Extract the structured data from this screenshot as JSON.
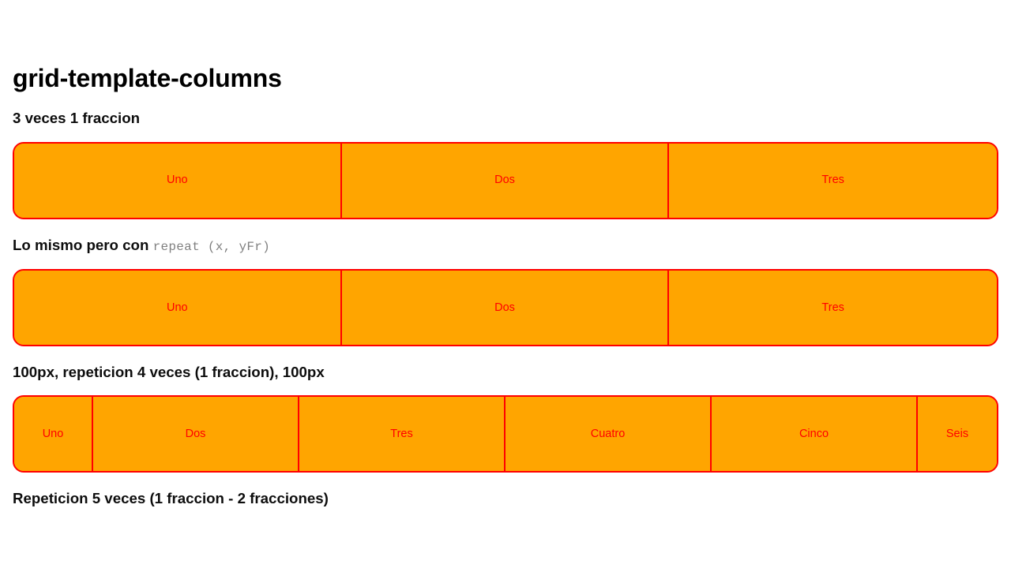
{
  "page": {
    "title": "grid-template-columns",
    "background_color": "#ffffff",
    "accent_fill": "#ffa500",
    "accent_border": "#ff0000",
    "accent_text": "#ff0000",
    "code_text_color": "#808080"
  },
  "sections": [
    {
      "heading": "3 veces 1 fraccion",
      "heading_code": "",
      "cells": [
        "Uno",
        "Dos",
        "Tres"
      ]
    },
    {
      "heading": "Lo mismo pero con ",
      "heading_code": "repeat (x, yFr)",
      "cells": [
        "Uno",
        "Dos",
        "Tres"
      ]
    },
    {
      "heading": "100px, repeticion 4 veces (1 fraccion), 100px",
      "heading_code": "",
      "cells": [
        "Uno",
        "Dos",
        "Tres",
        "Cuatro",
        "Cinco",
        "Seis"
      ]
    },
    {
      "heading": "Repeticion 5 veces (1 fraccion - 2 fracciones)",
      "heading_code": "",
      "cells": []
    }
  ]
}
